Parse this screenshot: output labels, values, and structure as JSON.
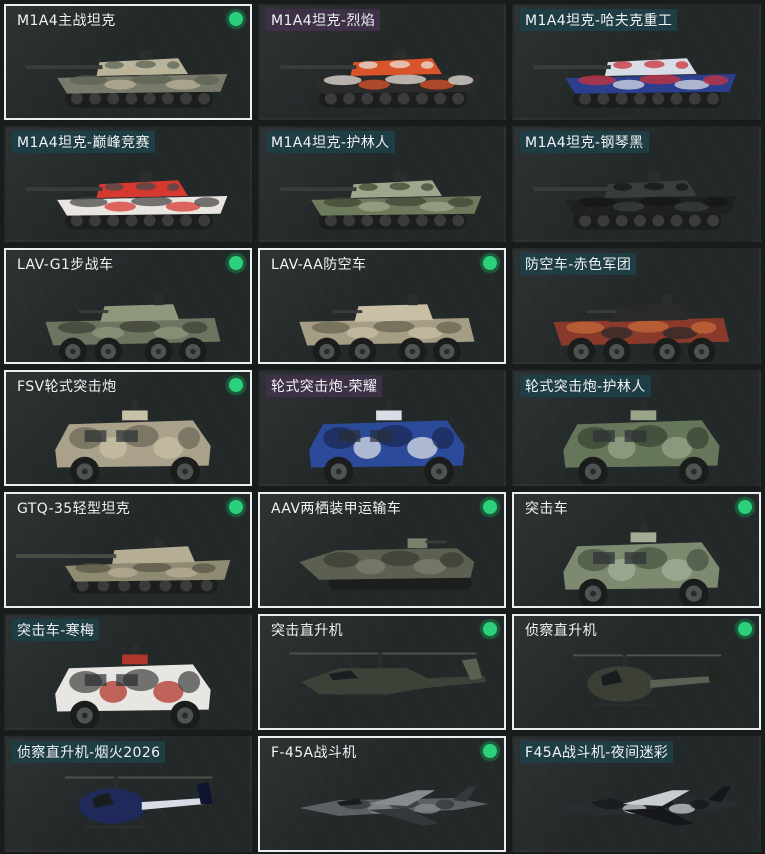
{
  "vehicles": [
    {
      "name": "M1A4主战坦克",
      "kind": "tank",
      "owned": true,
      "label_style": "none",
      "palette": [
        "#7a7a6a",
        "#b9b49a",
        "#5d6456"
      ]
    },
    {
      "name": "M1A4坦克-烈焰",
      "kind": "tank",
      "owned": false,
      "label_style": "purple",
      "palette": [
        "#2b2b2b",
        "#d9532b",
        "#e8e0d8"
      ]
    },
    {
      "name": "M1A4坦克-哈夫克重工",
      "kind": "tank",
      "owned": false,
      "label_style": "teal",
      "palette": [
        "#2c3f8f",
        "#d8dce6",
        "#c9333a"
      ]
    },
    {
      "name": "M1A4坦克-巅峰竞赛",
      "kind": "tank",
      "owned": false,
      "label_style": "teal",
      "palette": [
        "#e9e6e2",
        "#d6392f",
        "#4a4a4a"
      ]
    },
    {
      "name": "M1A4坦克-护林人",
      "kind": "tank",
      "owned": false,
      "label_style": "teal",
      "palette": [
        "#6e7a5c",
        "#9fa68c",
        "#3f4836"
      ]
    },
    {
      "name": "M1A4坦克-钢琴黑",
      "kind": "tank",
      "owned": false,
      "label_style": "teal",
      "palette": [
        "#1f2121",
        "#3a3d3e",
        "#151616"
      ]
    },
    {
      "name": "LAV-G1步战车",
      "kind": "apc",
      "owned": true,
      "label_style": "none",
      "palette": [
        "#6d7560",
        "#8f977d",
        "#3d4236"
      ]
    },
    {
      "name": "LAV-AA防空车",
      "kind": "apc",
      "owned": true,
      "label_style": "none",
      "palette": [
        "#a59d84",
        "#c8bfa4",
        "#6a6552"
      ]
    },
    {
      "name": "防空车-赤色军团",
      "kind": "apc",
      "owned": false,
      "label_style": "teal",
      "palette": [
        "#8a3a2a",
        "#2a2a2a",
        "#c46a3a"
      ]
    },
    {
      "name": "FSV轮式突击炮",
      "kind": "armored-car",
      "owned": true,
      "label_style": "none",
      "palette": [
        "#a9a189",
        "#c8c1a8",
        "#6d6a5a"
      ]
    },
    {
      "name": "轮式突击炮-荣耀",
      "kind": "armored-car",
      "owned": false,
      "label_style": "purple",
      "palette": [
        "#2c4a9a",
        "#d8dde6",
        "#1b2a55"
      ]
    },
    {
      "name": "轮式突击炮-护林人",
      "kind": "armored-car",
      "owned": false,
      "label_style": "teal",
      "palette": [
        "#66765a",
        "#9aa48a",
        "#3c4634"
      ]
    },
    {
      "name": "GTQ-35轻型坦克",
      "kind": "light-tank",
      "owned": true,
      "label_style": "none",
      "palette": [
        "#8f8a72",
        "#b5ae94",
        "#5a5848"
      ]
    },
    {
      "name": "AAV两栖装甲运输车",
      "kind": "amphibious",
      "owned": true,
      "label_style": "none",
      "palette": [
        "#5b6050",
        "#7a806c",
        "#3a3d33"
      ]
    },
    {
      "name": "突击车",
      "kind": "armored-car",
      "owned": true,
      "label_style": "none",
      "palette": [
        "#7e8a70",
        "#a3ad95",
        "#4b5443"
      ]
    },
    {
      "name": "突击车-寒梅",
      "kind": "armored-car",
      "owned": false,
      "label_style": "teal",
      "palette": [
        "#e7e6e3",
        "#b0352c",
        "#4a4a4a"
      ]
    },
    {
      "name": "突击直升机",
      "kind": "attack-heli",
      "owned": true,
      "label_style": "none",
      "palette": [
        "#3d4238",
        "#5a6050",
        "#262a24"
      ]
    },
    {
      "name": "侦察直升机",
      "kind": "scout-heli",
      "owned": true,
      "label_style": "none",
      "palette": [
        "#3b3f36",
        "#5b6152",
        "#242622"
      ]
    },
    {
      "name": "侦察直升机-烟火2026",
      "kind": "scout-heli",
      "owned": false,
      "label_style": "teal",
      "palette": [
        "#1f2a5a",
        "#d8dce6",
        "#0f1430"
      ]
    },
    {
      "name": "F-45A战斗机",
      "kind": "jet",
      "owned": true,
      "label_style": "none",
      "palette": [
        "#5c6264",
        "#868c8e",
        "#34383a"
      ]
    },
    {
      "name": "F45A战斗机-夜间迷彩",
      "kind": "jet",
      "owned": false,
      "label_style": "teal",
      "palette": [
        "#2a2d30",
        "#c9cdd0",
        "#15171a"
      ]
    }
  ]
}
